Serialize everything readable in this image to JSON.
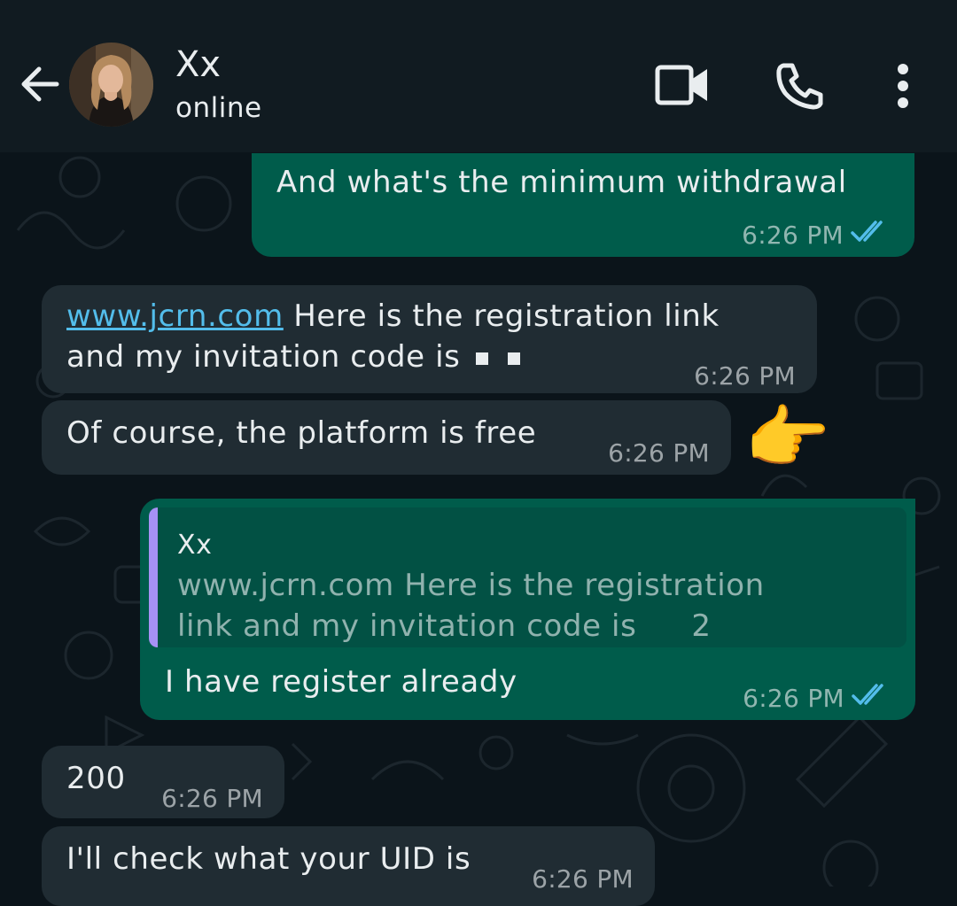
{
  "header": {
    "contact_name": "Xx",
    "status": "online",
    "icons": [
      "back-arrow-icon",
      "video-call-icon",
      "phone-icon",
      "more-options-icon"
    ]
  },
  "colors": {
    "header_bg": "#111b21",
    "chat_bg": "#0b141a",
    "outgoing_bubble": "#005c4b",
    "incoming_bubble": "#202c33",
    "link": "#53bdeb",
    "read_ticks": "#53bdeb",
    "quote_bar": "#a791f5"
  },
  "messages": [
    {
      "direction": "out",
      "text": "And what's the minimum withdrawal",
      "time": "6:26 PM",
      "status": "read"
    },
    {
      "direction": "in",
      "link": "www.jcrn.com",
      "text_line1": " Here is the registration link",
      "text_line2": "and my invitation code is",
      "time": "6:26 PM"
    },
    {
      "direction": "in",
      "text": "Of course, the platform is free",
      "time": "6:26 PM",
      "emoji": "👉"
    },
    {
      "direction": "out",
      "quote": {
        "author": "Xx",
        "line1": "www.jcrn.com Here is the registration",
        "line2": "link and my invitation code is",
        "line2_tail": "2"
      },
      "text": "I have register already",
      "time": "6:26 PM",
      "status": "read"
    },
    {
      "direction": "in",
      "text": "200",
      "time": "6:26 PM"
    },
    {
      "direction": "in",
      "text": "I'll check what your UID is",
      "time": "6:26 PM"
    }
  ]
}
